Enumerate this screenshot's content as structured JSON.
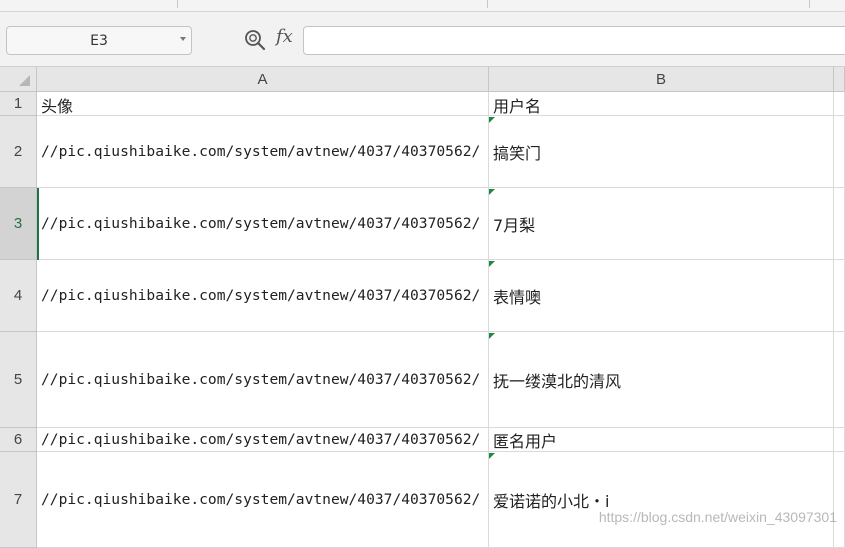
{
  "formula_bar": {
    "name_box": "E3",
    "fx_label": "fx",
    "formula_value": ""
  },
  "columns": [
    "A",
    "B"
  ],
  "rows": [
    {
      "num": "1",
      "a": "头像",
      "b": "用户名"
    },
    {
      "num": "2",
      "a": "//pic.qiushibaike.com/system/avtnew/4037/40370562/",
      "b": "搞笑门"
    },
    {
      "num": "3",
      "a": "//pic.qiushibaike.com/system/avtnew/4037/40370562/",
      "b": "7月梨"
    },
    {
      "num": "4",
      "a": "//pic.qiushibaike.com/system/avtnew/4037/40370562/",
      "b": "表情噢"
    },
    {
      "num": "5",
      "a": "//pic.qiushibaike.com/system/avtnew/4037/40370562/",
      "b": "抚一缕漠北的清风"
    },
    {
      "num": "6",
      "a": "//pic.qiushibaike.com/system/avtnew/4037/40370562/",
      "b": "匿名用户"
    },
    {
      "num": "7",
      "a": "//pic.qiushibaike.com/system/avtnew/4037/40370562/",
      "b": "爱诺诺的小北・i"
    }
  ],
  "active_row": "3",
  "watermark": "https://blog.csdn.net/weixin_43097301",
  "colors": {
    "active": "#217346",
    "tick": "#1d8a3e"
  }
}
